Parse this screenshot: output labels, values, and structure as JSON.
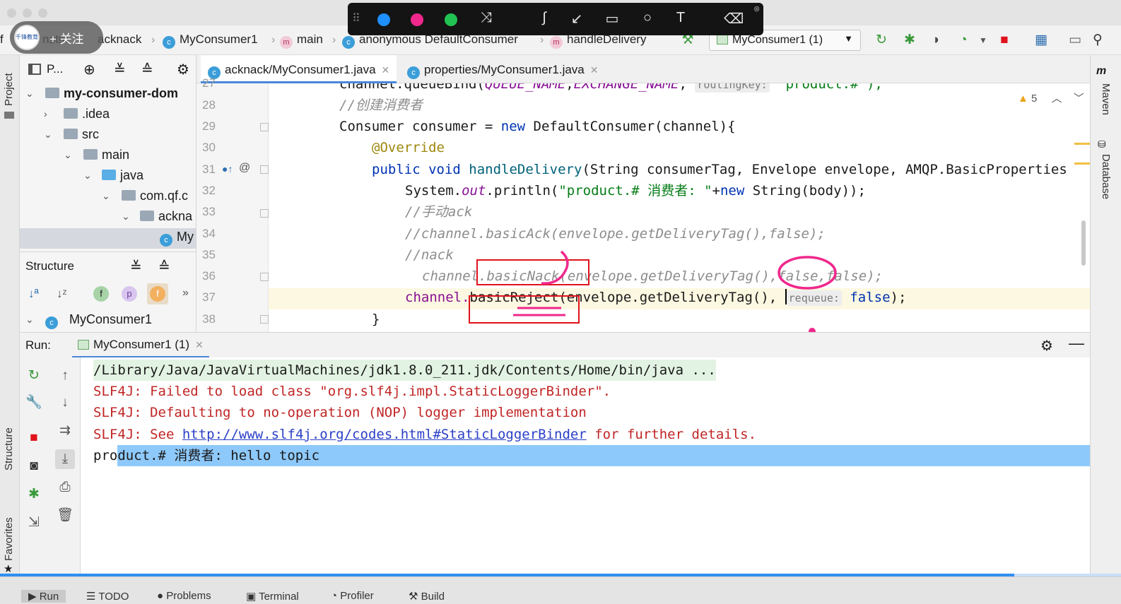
{
  "navbar": {
    "crumbs": [
      "nstm",
      "acknack",
      "MyConsumer1",
      "main",
      "anonymous DefaultConsumer",
      "handleDelivery"
    ],
    "run_config": "MyConsumer1 (1)"
  },
  "follow_overlay": {
    "label": "+ 关注",
    "logo_text": "千锋教育"
  },
  "annotation_toolbar": {
    "colors": [
      "#1e90ff",
      "#f0288c",
      "#21c452"
    ],
    "tools": [
      "shuffle-icon",
      "curve-icon",
      "arrow-icon",
      "rectangle-icon",
      "circle-icon",
      "text-icon",
      "eraser-icon"
    ],
    "text_tool_label": "T"
  },
  "left_stripe": {
    "project_label": "Project",
    "structure_label": "Structure",
    "favorites_label": "Favorites"
  },
  "project_pane": {
    "header_label": "P...",
    "tree": [
      {
        "label": "my-consumer-dom",
        "bold": true
      },
      {
        "label": ".idea"
      },
      {
        "label": "src"
      },
      {
        "label": "main"
      },
      {
        "label": "java"
      },
      {
        "label": "com.qf.c"
      },
      {
        "label": "ackna"
      },
      {
        "label": "My"
      }
    ],
    "structure_label": "Structure",
    "structure_item": "MyConsumer1",
    "struct_badges": [
      "f",
      "p",
      "f"
    ]
  },
  "editor": {
    "tabs": [
      {
        "label": "acknack/MyConsumer1.java",
        "active": true
      },
      {
        "label": "properties/MyConsumer1.java",
        "active": false
      }
    ],
    "warning_count": "5",
    "line_numbers": [
      "27",
      "28",
      "29",
      "30",
      "31",
      "32",
      "33",
      "34",
      "35",
      "36",
      "37",
      "38"
    ],
    "line36_gutter_comment": "//",
    "code": {
      "l27_a": "channel.queueBind(",
      "l27_b": "QUEUE_NAME",
      "l27_c": ",",
      "l27_d": "EXCHANGE_NAME",
      "l27_e": ", ",
      "l27_hint": "routingKey:",
      "l27_f": " \"product.#\");",
      "l28": "//创建消费者",
      "l29_a": "Consumer consumer = ",
      "l29_b": "new",
      "l29_c": " DefaultConsumer(channel){",
      "l30": "@Override",
      "l31_a": "public void ",
      "l31_b": "handleDelivery",
      "l31_c": "(String consumerTag, Envelope envelope, AMQP.BasicProperties",
      "l32_a": "System.",
      "l32_b": "out",
      "l32_c": ".println(",
      "l32_d": "\"product.# 消费者: \"",
      "l32_e": "+",
      "l32_f": "new",
      "l32_g": " String(body));",
      "l33": "//手动ack",
      "l34": "//channel.basicAck(envelope.getDeliveryTag(),false);",
      "l35": "//nack",
      "l36": "channel.basicNack(envelope.getDeliveryTag(),false,false);",
      "l37_a": "channel.",
      "l37_b": "basicReject",
      "l37_c": "(envelope.getDeliveryTag(), ",
      "l37_hint": "requeue:",
      "l37_d": " false",
      "l37_e": ");",
      "l38": "}"
    }
  },
  "right_stripe": {
    "maven_label": "Maven",
    "database_label": "Database"
  },
  "run_panel": {
    "label": "Run:",
    "tab_label": "MyConsumer1 (1)",
    "console": [
      "/Library/Java/JavaVirtualMachines/jdk1.8.0_211.jdk/Contents/Home/bin/java ...",
      "SLF4J: Failed to load class \"org.slf4j.impl.StaticLoggerBinder\".",
      "SLF4J: Defaulting to no-operation (NOP) logger implementation",
      "product.# 消费者: hello topic"
    ],
    "see_prefix": "SLF4J: See ",
    "see_link": "http://www.slf4j.org/codes.html#StaticLoggerBinder",
    "see_suffix": " for further details."
  },
  "bottom_bar": {
    "tabs": [
      "Run",
      "TODO",
      "Problems",
      "Terminal",
      "Profiler",
      "Build"
    ],
    "video_progress": 0.905
  },
  "colors": {
    "keyword": "#0033b3",
    "string": "#067d17",
    "annotation_red": "#e0121c",
    "pink_marker": "#f0288c",
    "selection": "#8ec9fb"
  }
}
